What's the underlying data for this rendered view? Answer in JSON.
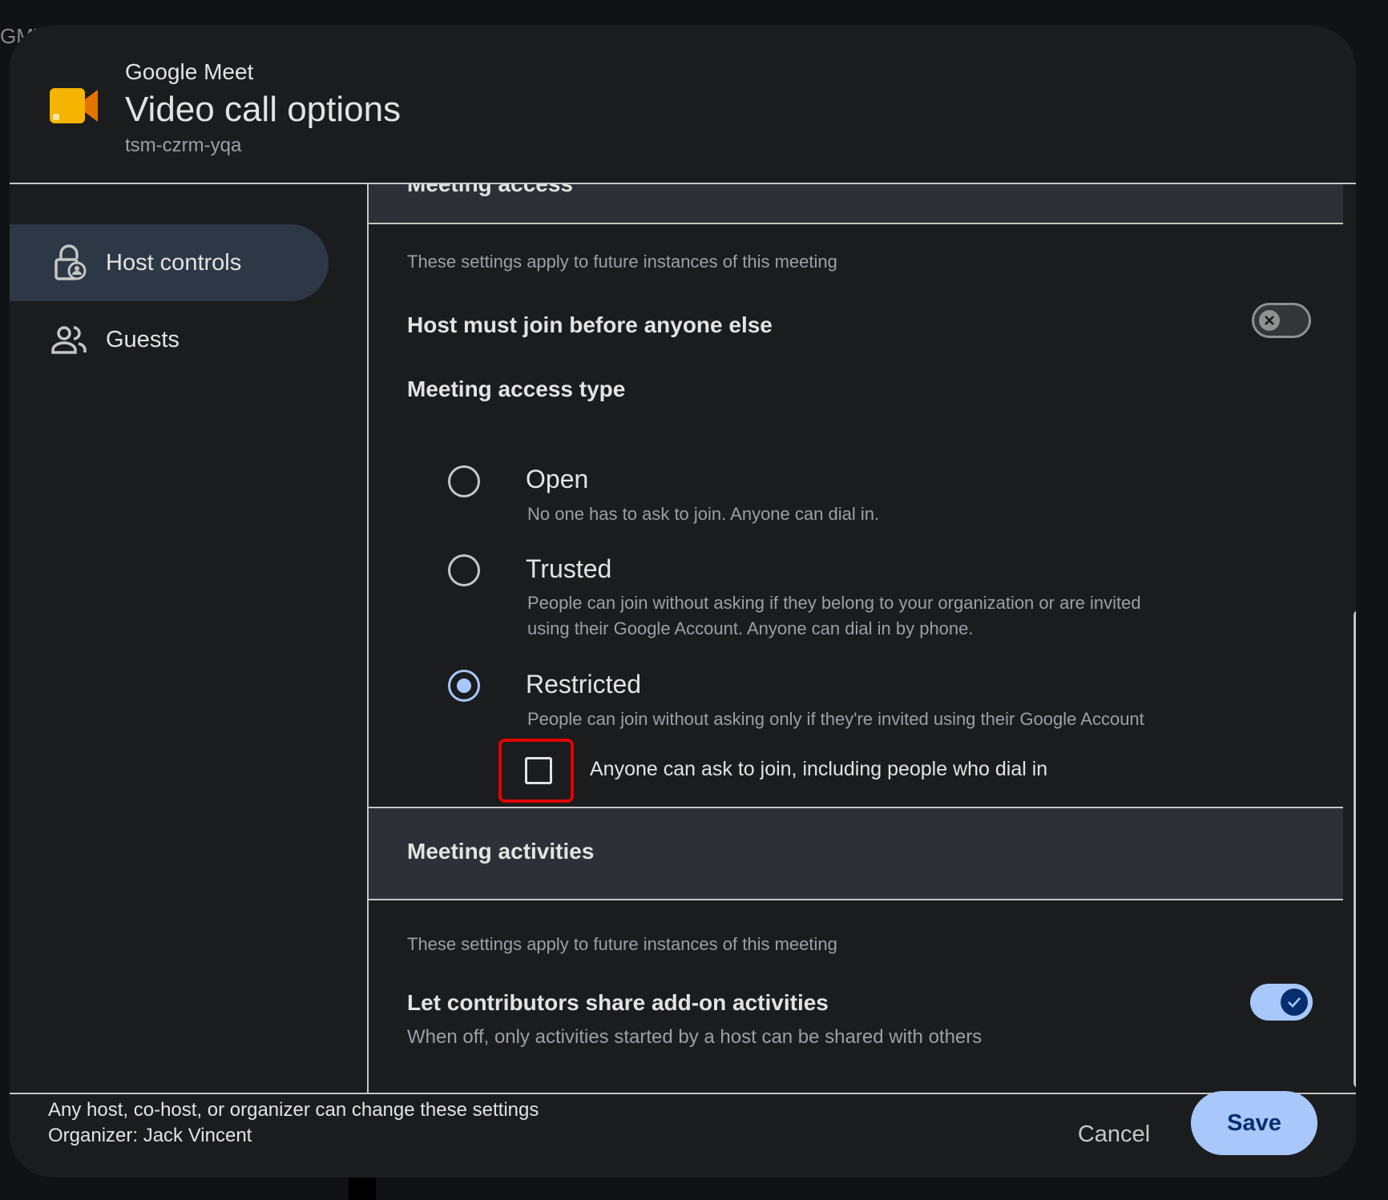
{
  "background": {
    "fragment_text": "GMT"
  },
  "header": {
    "app_name": "Google Meet",
    "title": "Video call options",
    "meeting_code": "tsm-czrm-yqa",
    "logo_icon": "google-meet-icon"
  },
  "sidebar": {
    "items": [
      {
        "label": "Host controls",
        "icon": "lock-person-icon",
        "active": true
      },
      {
        "label": "Guests",
        "icon": "people-icon",
        "active": false
      }
    ]
  },
  "meeting_access": {
    "section_title": "Meeting access",
    "note": "These settings apply to future instances of this meeting",
    "host_must_join_label": "Host must join before anyone else",
    "host_must_join_enabled": false,
    "access_type_label": "Meeting access type",
    "options": [
      {
        "title": "Open",
        "desc": "No one has to ask to join. Anyone can dial in.",
        "selected": false
      },
      {
        "title": "Trusted",
        "desc_line1": "People can join without asking if they belong to your organization or are invited",
        "desc_line2": "using their Google Account. Anyone can dial in by phone.",
        "selected": false
      },
      {
        "title": "Restricted",
        "desc": "People can join without asking only if they're invited using their Google Account",
        "selected": true
      }
    ],
    "ask_to_join_label": "Anyone can ask to join, including people who dial in",
    "ask_to_join_checked": false
  },
  "meeting_activities": {
    "section_title": "Meeting activities",
    "note": "These settings apply to future instances of this meeting",
    "share_addon_label": "Let contributors share add-on activities",
    "share_addon_desc": "When off, only activities started by a host can be shared with others",
    "share_addon_enabled": true
  },
  "footer": {
    "line1": "Any host, co-host, or organizer can change these settings",
    "line2": "Organizer: Jack Vincent",
    "cancel_label": "Cancel",
    "save_label": "Save"
  },
  "colors": {
    "accent": "#a8c7fa",
    "dialog_bg": "#1b1c1e",
    "section_header_bg": "#2d3137",
    "nav_active_bg": "#2d3745",
    "highlight": "#e10000",
    "meet_yellow": "#f4b400",
    "meet_orange": "#e37400"
  }
}
